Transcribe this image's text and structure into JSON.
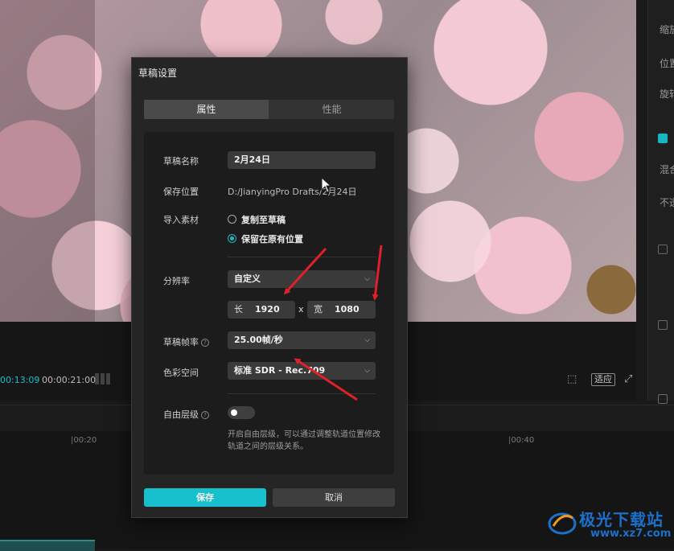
{
  "right_panel": {
    "labels": [
      "缩放",
      "位置",
      "旋转",
      "混合",
      "不透"
    ]
  },
  "player": {
    "current_time": "00:13:09",
    "total_time": "00:00:21:00",
    "ratio_label": "适应"
  },
  "timeline": {
    "ruler": [
      "|00:20",
      "|00:40"
    ]
  },
  "dialog": {
    "title": "草稿设置",
    "tabs": [
      {
        "label": "属性",
        "active": true
      },
      {
        "label": "性能",
        "active": false
      }
    ],
    "draft_name": {
      "label": "草稿名称",
      "value": "2月24日"
    },
    "save_location": {
      "label": "保存位置",
      "value": "D:/JianyingPro Drafts/2月24日"
    },
    "import_media": {
      "label": "导入素材",
      "options": [
        {
          "label": "复制至草稿",
          "selected": false
        },
        {
          "label": "保留在原有位置",
          "selected": true
        }
      ]
    },
    "resolution": {
      "label": "分辨率",
      "value": "自定义",
      "width_prefix": "长",
      "width": "1920",
      "separator": "x",
      "height_prefix": "宽",
      "height": "1080"
    },
    "frame_rate": {
      "label": "草稿帧率",
      "value": "25.00帧/秒"
    },
    "color_space": {
      "label": "色彩空间",
      "value": "标准 SDR - Rec.709"
    },
    "free_layer": {
      "label": "自由层级",
      "enabled": false,
      "hint": "开启自由层级，可以通过调整轨道位置修改轨道之间的层级关系。"
    },
    "save_label": "保存",
    "cancel_label": "取消"
  },
  "colors": {
    "accent": "#16c0cc",
    "annotation_arrow": "#e0202a"
  },
  "watermark": {
    "text": "极光下载站",
    "url": "www.xz7.com"
  }
}
